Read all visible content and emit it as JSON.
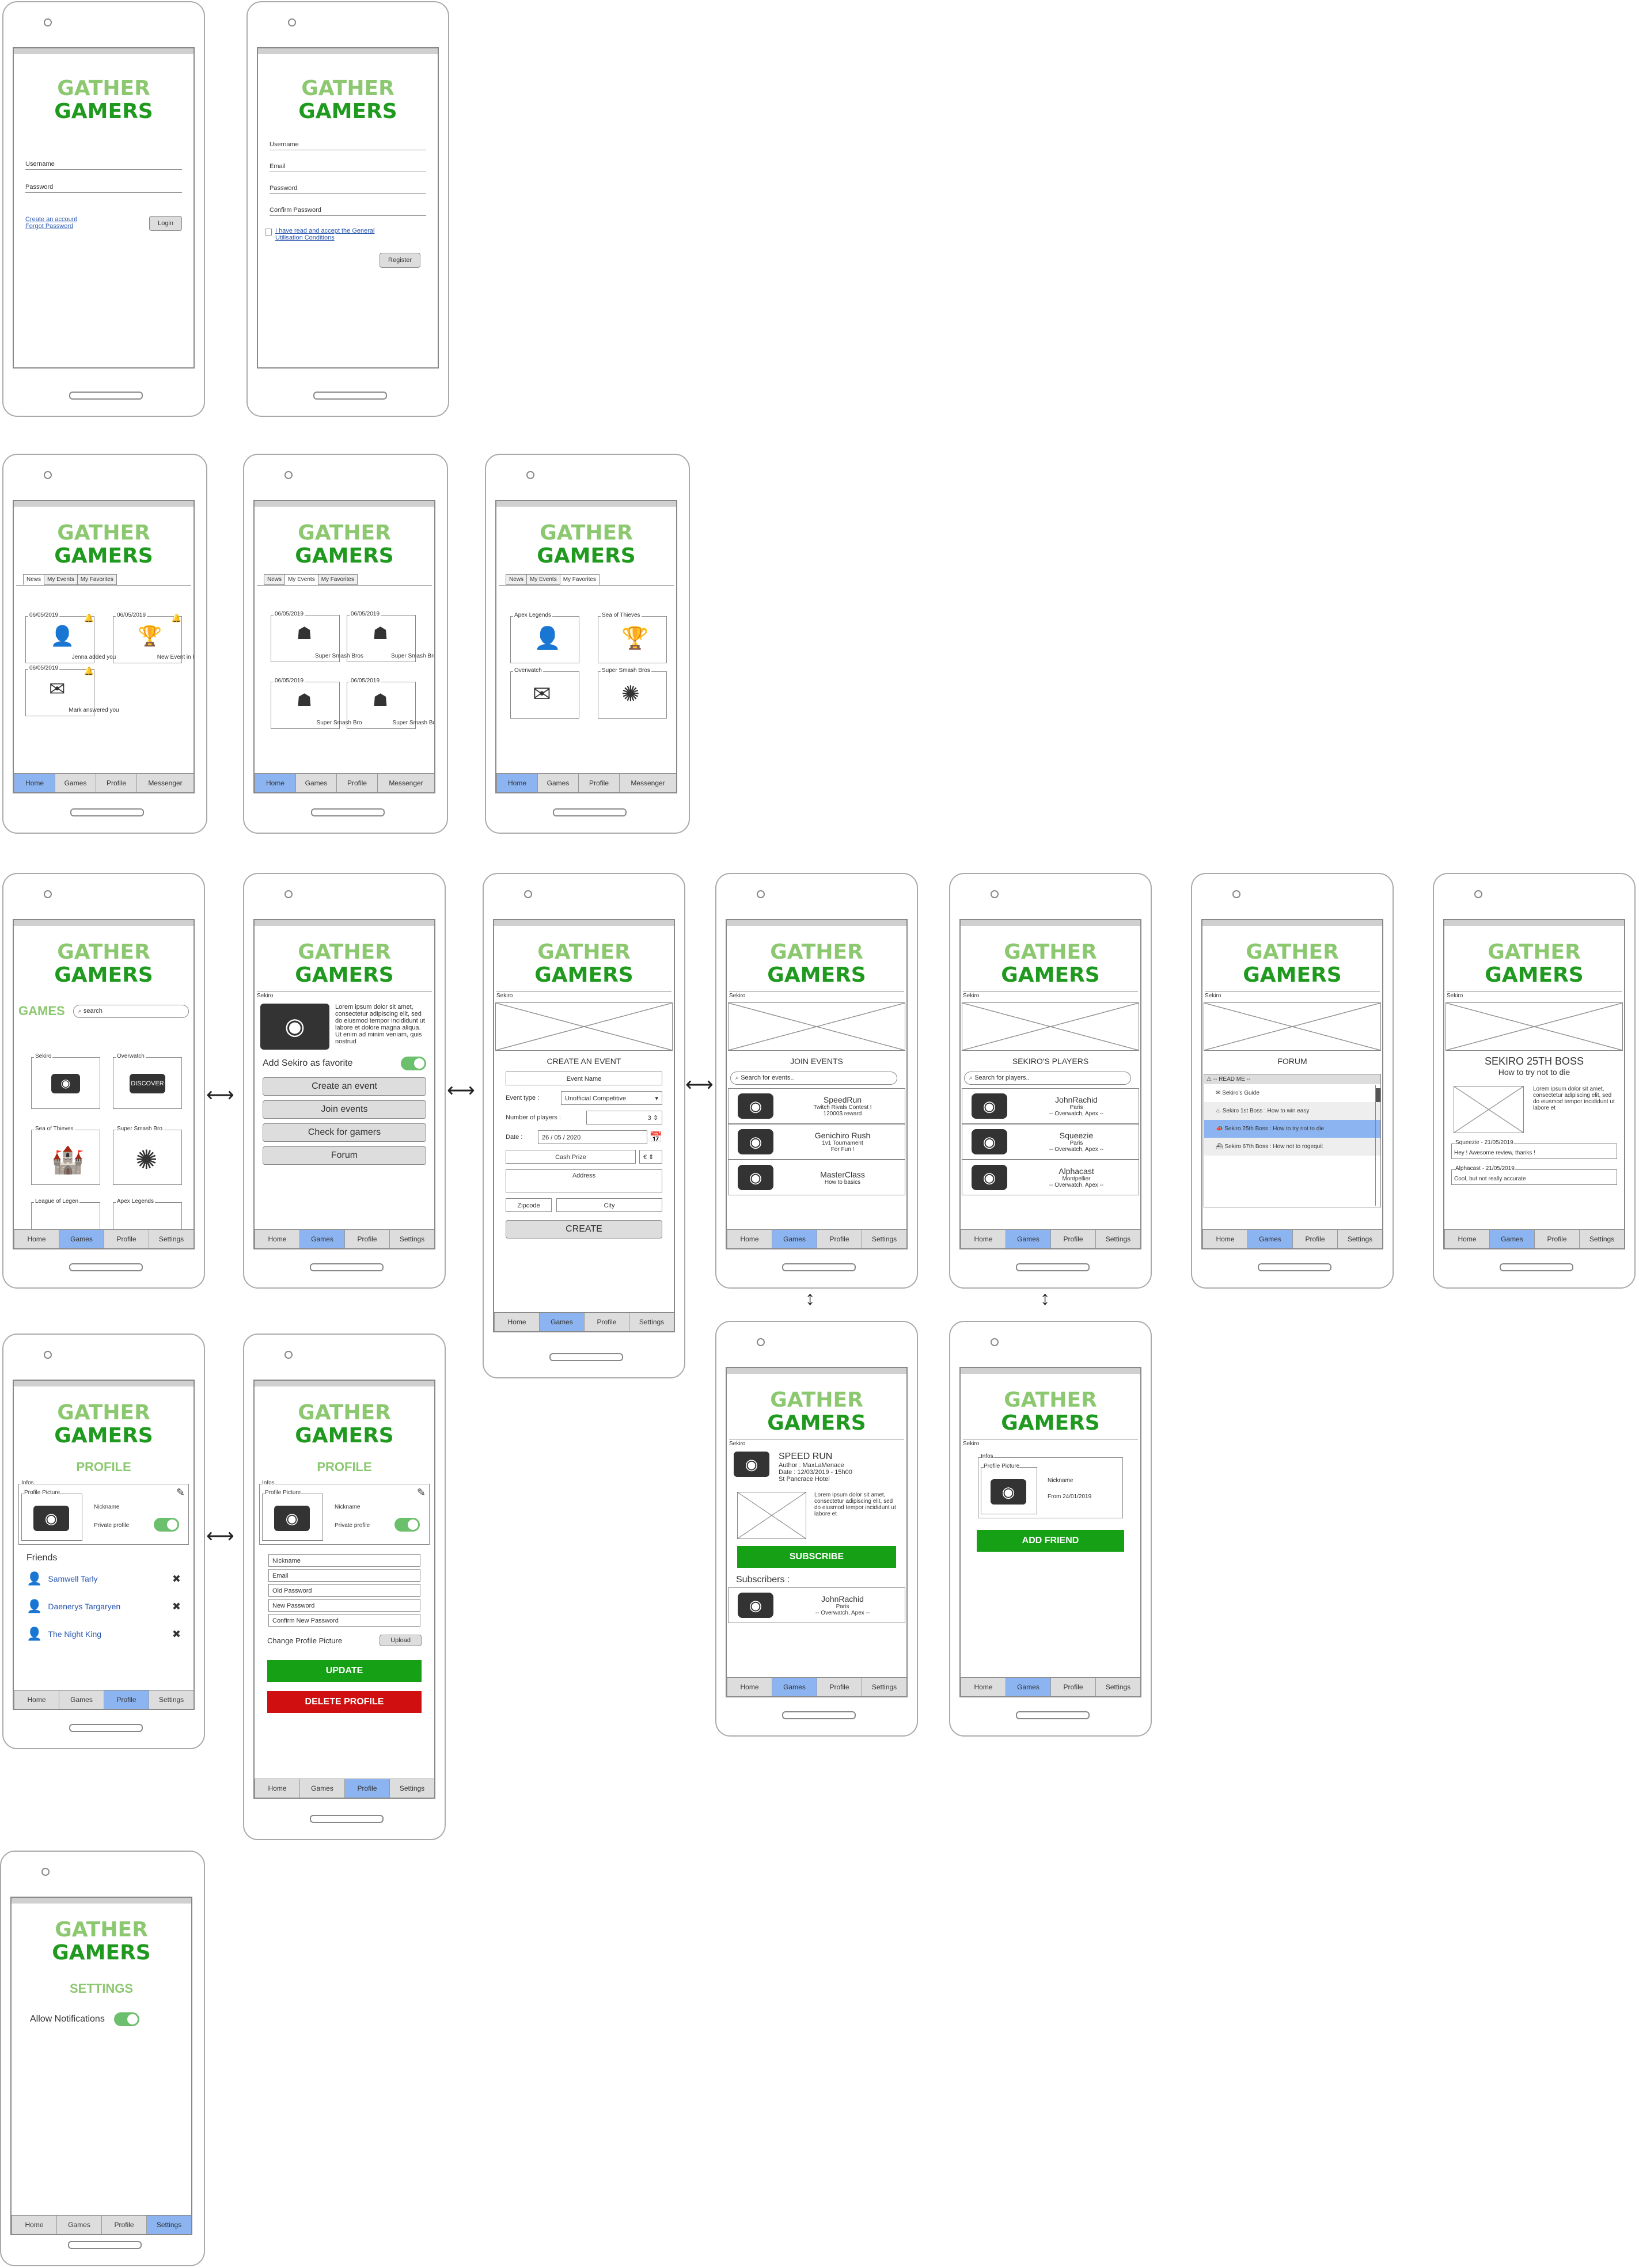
{
  "logo": {
    "line1": "GATHER",
    "line2": "GAMERS"
  },
  "tabs": {
    "home": "Home",
    "games": "Games",
    "profile": "Profile",
    "messenger": "Messenger",
    "settings": "Settings"
  },
  "login": {
    "username": "Username",
    "password": "Password",
    "create": "Create an account",
    "forgot": "Forgot Password",
    "btn": "Login"
  },
  "register": {
    "username": "Username",
    "email": "Email",
    "password": "Password",
    "confirm": "Confirm Password",
    "terms": "I have read and accept the General Utilisation Conditions",
    "btn": "Register"
  },
  "home": {
    "tabs": [
      "News",
      "My Events",
      "My Favorites"
    ],
    "news": [
      {
        "date": "06/05/2019",
        "text": "Jenna added you"
      },
      {
        "date": "06/05/2019",
        "text": "New Event in Paris"
      },
      {
        "date": "06/05/2019",
        "text": "Mark answered you"
      }
    ],
    "events": [
      {
        "date": "06/05/2019",
        "text": "Super Smash Bros"
      },
      {
        "date": "06/05/2019",
        "text": "Super Smash Bros"
      },
      {
        "date": "06/05/2019",
        "text": "Super Smash Bro"
      },
      {
        "date": "06/05/2019",
        "text": "Super Smash Bro"
      }
    ],
    "favorites": [
      "Apex Legends",
      "Sea of Thieves",
      "Overwatch",
      "Super Smash Bros"
    ]
  },
  "games": {
    "title": "GAMES",
    "search": "search",
    "list": [
      "Sekiro",
      "Overwatch",
      "Sea of Thieves",
      "Super Smash Bro",
      "League of Legen",
      "Apex Legends"
    ],
    "discover": "DISCOVER"
  },
  "game_detail": {
    "section": "Sekiro",
    "lorem": "Lorem ipsum dolor sit amet, consectetur adipiscing elit, sed do eiusmod tempor incididunt ut labore et dolore magna aliqua. Ut enim ad minim veniam, quis nostrud",
    "fav": "Add Sekiro as favorite",
    "buttons": [
      "Create an event",
      "Join events",
      "Check for gamers",
      "Forum"
    ]
  },
  "create_event": {
    "section": "Sekiro",
    "title": "CREATE AN EVENT",
    "name": "Event Name",
    "type_label": "Event type :",
    "type_value": "Unofficial Competitive",
    "players_label": "Number of players :",
    "players_value": "3",
    "date_label": "Date :",
    "date_value": "26 / 05 / 2020",
    "prize": "Cash Prize",
    "prize_value": "€",
    "address": "Address",
    "zip": "Zipcode",
    "city": "City",
    "btn": "CREATE"
  },
  "join_events": {
    "section": "Sekiro",
    "title": "JOIN EVENTS",
    "search": "Search for events..",
    "items": [
      {
        "name": "SpeedRun",
        "l1": "Twitch Rivals Contest !",
        "l2": "12000$ reward"
      },
      {
        "name": "Genichiro Rush",
        "l1": "1v1 Tournament",
        "l2": "For Fun !"
      },
      {
        "name": "MasterClass",
        "l1": "How to basics",
        "l2": ""
      }
    ]
  },
  "players": {
    "section": "Sekiro",
    "title": "SEKIRO'S PLAYERS",
    "search": "Search for players..",
    "items": [
      {
        "name": "JohnRachid",
        "l1": "Paris",
        "l2": "-- Overwatch, Apex --"
      },
      {
        "name": "Squeezie",
        "l1": "Paris",
        "l2": "-- Overwatch, Apex --"
      },
      {
        "name": "Alphacast",
        "l1": "Montpellier",
        "l2": "-- Overwatch, Apex --"
      }
    ]
  },
  "forum": {
    "section": "Sekiro",
    "title": "FORUM",
    "readme": "-- READ ME --",
    "items": [
      "Sekiro's Guide",
      "Sekiro 1st Boss : How to win easy",
      "Sekiro 25th Boss : How to try not to die",
      "Sekiro 67th Boss : How not to rogequit"
    ]
  },
  "thread": {
    "section": "Sekiro",
    "title": "SEKIRO 25TH BOSS",
    "subtitle": "How to try not to die",
    "lorem": "Lorem ipsum dolor sit amet, consectetur adipiscing elit, sed do eiusmod tempor incididunt ut labore et",
    "comments": [
      {
        "head": "Squeezie - 21/05/2019",
        "text": "Hey ! Awesome review, thanks !"
      },
      {
        "head": "Alphacast - 21/05/2019",
        "text": "Cool, but not really accurate"
      }
    ]
  },
  "event_detail": {
    "section": "Sekiro",
    "title": "SPEED RUN",
    "author": "Author : MaxLaMenace",
    "date": "Date : 12/03/2019 - 15h00",
    "place": "St Pancrace Hotel",
    "lorem": "Lorem ipsum dolor sit amet, consectetur adipiscing elit, sed do eiusmod tempor incididunt ut labore et",
    "btn": "SUBSCRIBE",
    "subs": "Subscribers :",
    "sub_name": "JohnRachid",
    "sub_l1": "Paris",
    "sub_l2": "-- Overwatch, Apex --"
  },
  "player_detail": {
    "section": "Sekiro",
    "infos": "Infos",
    "pic": "Profile Picture",
    "nick": "Nickname",
    "from": "From 24/01/2019",
    "btn": "ADD FRIEND"
  },
  "profile": {
    "title": "PROFILE",
    "infos": "Infos",
    "pic": "Profile Picture",
    "nick": "Nickname",
    "private": "Private profile",
    "friends_title": "Friends",
    "friends": [
      "Samwell Tarly",
      "Daenerys Targaryen",
      "The Night King"
    ]
  },
  "profile_edit": {
    "title": "PROFILE",
    "infos": "Infos",
    "pic": "Profile Picture",
    "nick": "Nickname",
    "private": "Private profile",
    "fields": [
      "Nickname",
      "Email",
      "Old Password",
      "New Password",
      "Confirm New Password"
    ],
    "change": "Change Profile Picture",
    "upload": "Upload",
    "update": "UPDATE",
    "delete": "DELETE PROFILE"
  },
  "settings": {
    "title": "SETTINGS",
    "notif": "Allow Notifications"
  },
  "colors": {
    "accent_light": "#8cc870",
    "accent_dark": "#1f9a1f",
    "tab_active": "#8cb4f0",
    "green_btn": "#16a016",
    "red_btn": "#d01010"
  }
}
